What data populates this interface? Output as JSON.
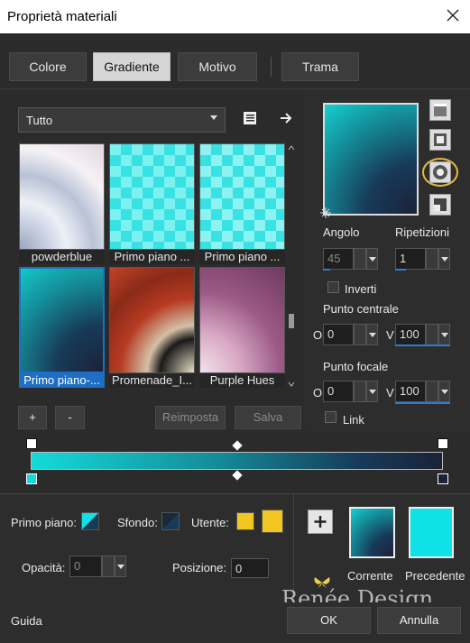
{
  "window": {
    "title": "Proprietà materiali"
  },
  "tabs": [
    {
      "label": "Colore"
    },
    {
      "label": "Gradiente"
    },
    {
      "label": "Motivo"
    },
    {
      "label": "Trama"
    }
  ],
  "category": {
    "value": "Tutto"
  },
  "gradients": [
    {
      "label": "powderblue"
    },
    {
      "label": "Primo piano ..."
    },
    {
      "label": "Primo piano ..."
    },
    {
      "label": "Primo piano-..."
    },
    {
      "label": "Promenade_I..."
    },
    {
      "label": "Purple Hues"
    }
  ],
  "buttons": {
    "add": "+",
    "remove": "-",
    "reset": "Reimposta",
    "save": "Salva"
  },
  "settings": {
    "angle_label": "Angolo",
    "angle_value": "45",
    "repeats_label": "Ripetizioni",
    "repeats_value": "1",
    "invert_label": "Inverti",
    "center_label": "Punto centrale",
    "center_o_label": "O",
    "center_o_value": "0",
    "center_v_label": "V",
    "center_v_value": "100",
    "focal_label": "Punto focale",
    "focal_o_label": "O",
    "focal_o_value": "0",
    "focal_v_label": "V",
    "focal_v_value": "100",
    "link_label": "Link"
  },
  "materials": {
    "foreground_label": "Primo piano:",
    "background_label": "Sfondo:",
    "user_label": "Utente:",
    "opacity_label": "Opacità:",
    "opacity_value": "0",
    "position_label": "Posizione:",
    "position_value": "0"
  },
  "preview": {
    "current_label": "Corrente",
    "previous_label": "Precedente"
  },
  "footer": {
    "help": "Guida",
    "ok": "OK",
    "cancel": "Annulla",
    "watermark": "Renée Design"
  },
  "colors": {
    "accent": "#1e6fc3",
    "gradient_start": "#14dada",
    "gradient_end": "#1b2238",
    "user_color": "#f2c523",
    "previous_color": "#0fe2e6",
    "highlight_ring": "#e8b93a"
  }
}
